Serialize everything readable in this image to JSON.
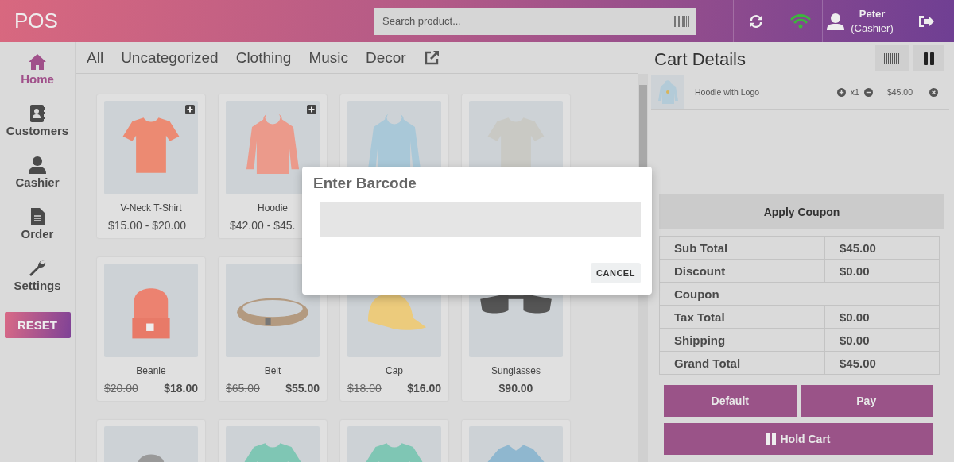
{
  "header": {
    "logo": "POS",
    "search": {
      "placeholder": "Search product..."
    },
    "online": true,
    "user": {
      "name": "Peter",
      "role": "(Cashier)"
    }
  },
  "sidebar": {
    "items": [
      {
        "label": "Home",
        "selected": true
      },
      {
        "label": "Customers",
        "selected": false
      },
      {
        "label": "Cashier",
        "selected": false
      },
      {
        "label": "Order",
        "selected": false
      },
      {
        "label": "Settings",
        "selected": false
      }
    ],
    "reset_button": "RESET"
  },
  "categories": [
    "All",
    "Uncategorized",
    "Clothing",
    "Music",
    "Decor"
  ],
  "products": [
    {
      "name": "V-Neck T-Shirt",
      "price": "$15.00 - $20.00",
      "has_options": true
    },
    {
      "name": "Hoodie",
      "price": "$42.00 - $45.",
      "has_options": true
    },
    {
      "kind": "picture"
    },
    {
      "kind": "picture"
    },
    {
      "name": "Beanie",
      "regular_price": "$20.00",
      "price": "$18.00"
    },
    {
      "name": "Belt",
      "regular_price": "$65.00",
      "price": "$55.00"
    },
    {
      "name": "Cap",
      "regular_price": "$18.00",
      "price": "$16.00"
    },
    {
      "name": "Sunglasses",
      "price": "$90.00"
    },
    {
      "kind": "picture"
    },
    {
      "kind": "picture"
    },
    {
      "kind": "picture"
    },
    {
      "kind": "picture"
    }
  ],
  "cart": {
    "title": "Cart Details",
    "items": [
      {
        "name": "Hoodie with Logo",
        "quantity": "x1",
        "price": "$45.00"
      }
    ],
    "apply_coupon": "Apply Coupon",
    "totals": [
      {
        "label": "Sub Total",
        "value": "$45.00"
      },
      {
        "label": "Discount",
        "value": "$0.00"
      },
      {
        "label": "Coupon"
      },
      {
        "label": "Tax Total",
        "value": "$0.00"
      },
      {
        "label": "Shipping",
        "value": "$0.00"
      },
      {
        "label": "Grand Total",
        "value": "$45.00"
      }
    ],
    "buttons": [
      "Default",
      "Pay"
    ],
    "hold_button": "Hold Cart"
  },
  "dialog": {
    "title": "Enter Barcode",
    "cancel": "CANCEL"
  }
}
